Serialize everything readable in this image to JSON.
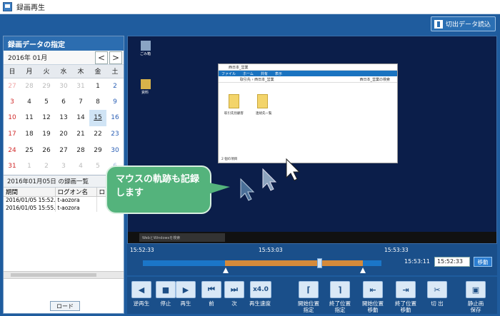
{
  "window": {
    "title": "録画再生"
  },
  "toolbar": {
    "load_data": "切出データ読込"
  },
  "calendar": {
    "section_title": "録画データの指定",
    "month": "2016年 01月",
    "prev": "<",
    "next": ">",
    "weekdays": [
      "日",
      "月",
      "火",
      "水",
      "木",
      "金",
      "土"
    ],
    "weeks": [
      [
        "27",
        "28",
        "29",
        "30",
        "31",
        "1",
        "2"
      ],
      [
        "3",
        "4",
        "5",
        "6",
        "7",
        "8",
        "9"
      ],
      [
        "10",
        "11",
        "12",
        "13",
        "14",
        "15",
        "16"
      ],
      [
        "17",
        "18",
        "19",
        "20",
        "21",
        "22",
        "23"
      ],
      [
        "24",
        "25",
        "26",
        "27",
        "28",
        "29",
        "30"
      ],
      [
        "31",
        "1",
        "2",
        "3",
        "4",
        "5",
        "6"
      ]
    ],
    "selected": "15"
  },
  "recordings": {
    "title": "2016年01月05日 の録画一覧",
    "columns": [
      "期間",
      "ログオン名",
      "ロ"
    ],
    "rows": [
      [
        "2016/01/05 15:52...",
        "t-aozora",
        ""
      ],
      [
        "2016/01/05 15:55...",
        "t-aozora",
        ""
      ]
    ],
    "load_button": "ロード"
  },
  "video": {
    "desktop_icons": [
      "ごみ箱",
      "資料"
    ],
    "explorer_title": "西日本_営業",
    "explorer_tabs": [
      "ファイル",
      "ホーム",
      "共有",
      "表示"
    ],
    "explorer_address": "取引先 › 西日本_営業",
    "explorer_search": "西日本_営業の検索",
    "folders": [
      "取引先別顧客",
      "連絡先一覧"
    ],
    "status": "2 個の項目",
    "taskbar_search": "WebとWindowsを検索",
    "callout": "マウスの軌跡も記録します"
  },
  "timeline": {
    "ticks": [
      "15:52:33",
      "15:53:03",
      "15:53:33"
    ],
    "current_time": "15:53:11",
    "time_input": "15:52:33",
    "move_button": "移動"
  },
  "controls": [
    {
      "icon": "◀",
      "label": "逆再生"
    },
    {
      "icon": "■",
      "label": "停止"
    },
    {
      "icon": "▶",
      "label": "再生"
    },
    {
      "icon": "⏮",
      "label": "前"
    },
    {
      "icon": "⏭",
      "label": "次"
    },
    {
      "icon": "x4.0",
      "label": "再生速度"
    },
    {
      "icon": "⌈",
      "label": "開始位置\n指定"
    },
    {
      "icon": "⌉",
      "label": "終了位置\n指定"
    },
    {
      "icon": "⇤",
      "label": "開始位置\n移動"
    },
    {
      "icon": "⇥",
      "label": "終了位置\n移動"
    },
    {
      "icon": "✂",
      "label": "切 出"
    },
    {
      "icon": "▣",
      "label": "静止画\n保存"
    }
  ]
}
